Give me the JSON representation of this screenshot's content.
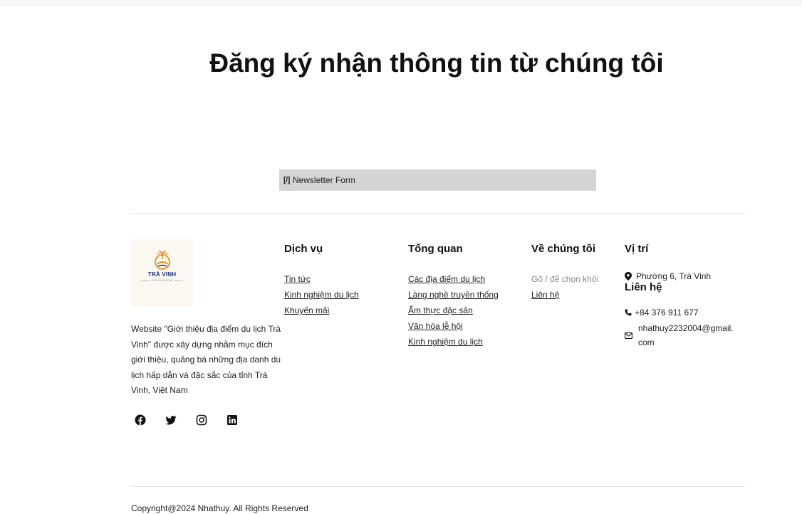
{
  "newsletter": {
    "title": "Đăng ký nhận thông tin từ chúng tôi",
    "form_tag": "[/]",
    "form_label": "Newsletter Form"
  },
  "footer": {
    "logo": {
      "brand": "TRÀ VINH",
      "tagline": "CÙNG KHÁM PHÁ"
    },
    "about": "Website \"Giới thiệu địa điểm du lịch Trà Vinh\" được xây dựng nhằm mục đích giới thiệu, quảng bá những địa danh du lịch hấp dẫn và đặc sắc của tỉnh Trà Vinh, Việt Nam",
    "social": [
      "facebook-icon",
      "twitter-icon",
      "instagram-icon",
      "linkedin-icon"
    ],
    "columns": {
      "dich_vu": {
        "title": "Dịch vụ",
        "items": [
          "Tin tức",
          "Kinh nghiệm du lịch",
          "Khuyến mãi"
        ]
      },
      "tong_quan": {
        "title": "Tổng quan",
        "items": [
          "Các địa điểm du lịch",
          "Làng nghề truyền thống",
          "Ẩm thực đặc sản",
          "Văn hóa lễ hội",
          "Kinh nghiệm du lịch"
        ]
      },
      "ve_chung_toi": {
        "title": "Về chúng tôi",
        "placeholder": "Gõ / để chọn khối",
        "items": [
          "Liên hệ"
        ]
      },
      "vi_tri": {
        "title": "Vị trí",
        "address": "Phường 6, Trà Vinh"
      },
      "lien_he": {
        "title": "Liên hệ",
        "phone": "+84 376 911 677",
        "email_line1": "nhathuy2232004@gmail.",
        "email_line2": "com"
      }
    },
    "copyright": "Copyright@2024 Nhathuy. All Rights Reserved"
  },
  "colors": {
    "brand_navy": "#1e2c7a",
    "logo_orange": "#e8901c",
    "form_bg": "#d4d4d4"
  }
}
